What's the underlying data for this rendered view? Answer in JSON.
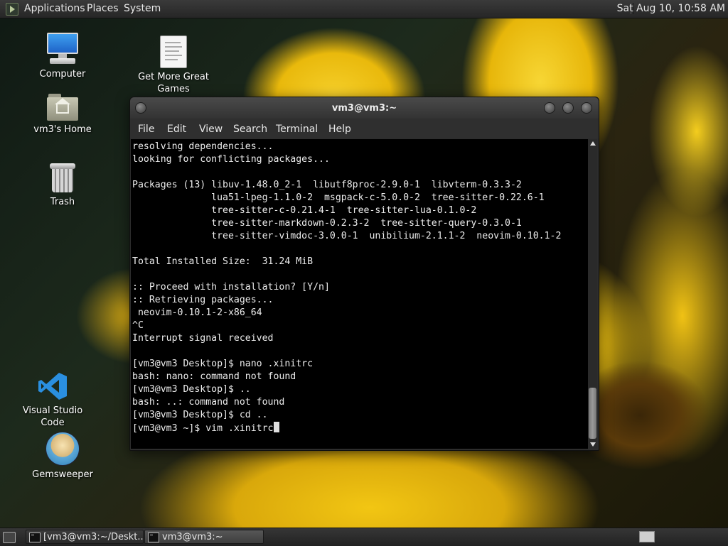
{
  "top_panel": {
    "menu": [
      "Applications",
      "Places",
      "System"
    ],
    "clock": "Sat Aug 10, 10:58 AM",
    "logo_icon": "terminal-logo-icon"
  },
  "desktop_icons": {
    "computer": {
      "label": "Computer",
      "icon": "computer-icon"
    },
    "games": {
      "label_line1": "Get More Great",
      "label_line2": "Games",
      "icon": "document-icon"
    },
    "home": {
      "label": "vm3's Home",
      "icon": "home-folder-icon"
    },
    "trash": {
      "label": "Trash",
      "icon": "trash-icon"
    },
    "vscode": {
      "label": "Visual Studio Code",
      "icon": "vscode-icon"
    },
    "gemsweeper": {
      "label": "Gemsweeper",
      "icon": "gemsweeper-icon"
    }
  },
  "terminal": {
    "title": "vm3@vm3:~",
    "menu": [
      "File",
      "Edit",
      "View",
      "Search",
      "Terminal",
      "Help"
    ],
    "output": "resolving dependencies...\nlooking for conflicting packages...\n\nPackages (13) libuv-1.48.0_2-1  libutf8proc-2.9.0-1  libvterm-0.3.3-2\n              lua51-lpeg-1.1.0-2  msgpack-c-5.0.0-2  tree-sitter-0.22.6-1\n              tree-sitter-c-0.21.4-1  tree-sitter-lua-0.1.0-2\n              tree-sitter-markdown-0.2.3-2  tree-sitter-query-0.3.0-1\n              tree-sitter-vimdoc-3.0.0-1  unibilium-2.1.1-2  neovim-0.10.1-2\n\nTotal Installed Size:  31.24 MiB\n\n:: Proceed with installation? [Y/n]\n:: Retrieving packages...\n neovim-0.10.1-2-x86_64\n^C\nInterrupt signal received\n\n[vm3@vm3 Desktop]$ nano .xinitrc\nbash: nano: command not found\n[vm3@vm3 Desktop]$ ..\nbash: ..: command not found\n[vm3@vm3 Desktop]$ cd ..\n[vm3@vm3 ~]$ vim .xinitrc"
  },
  "taskbar": {
    "tasks": [
      "[vm3@vm3:~/Deskt...",
      "vm3@vm3:~"
    ]
  },
  "colors": {
    "panel": "#2e2e2e",
    "terminal_bg": "#000000",
    "terminal_fg": "#ececec",
    "vscode_blue": "#2a8fe0"
  }
}
